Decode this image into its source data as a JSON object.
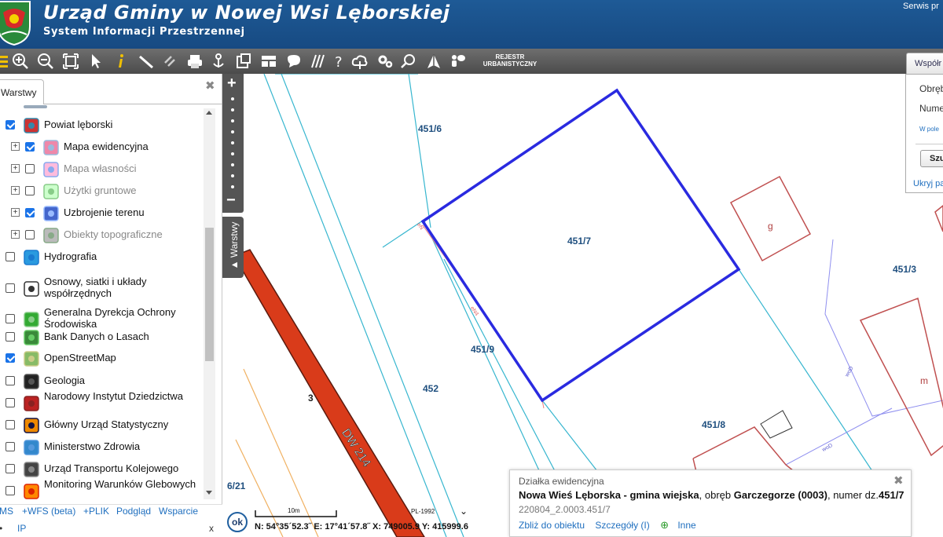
{
  "header": {
    "title": "Urząd Gminy w Nowej Wsi Lęborskiej",
    "subtitle": "System Informacji Przestrzennej",
    "serwis": "Serwis pr"
  },
  "toolbar": {
    "rejestr_line1": "REJESTR",
    "rejestr_line2": "URBANISTYCZNY",
    "tab_label": "Współr"
  },
  "layers_panel": {
    "tab_label": "Warstwy",
    "items": [
      {
        "label": "Powiat lęborski",
        "checked": true,
        "expander": false,
        "dim": false
      },
      {
        "label": "Mapa ewidencyjna",
        "checked": true,
        "expander": true,
        "dim": false
      },
      {
        "label": "Mapa własności",
        "checked": false,
        "expander": true,
        "dim": true
      },
      {
        "label": "Użytki gruntowe",
        "checked": false,
        "expander": true,
        "dim": true
      },
      {
        "label": "Uzbrojenie terenu",
        "checked": true,
        "expander": true,
        "dim": false
      },
      {
        "label": "Obiekty topograficzne",
        "checked": false,
        "expander": true,
        "dim": true
      },
      {
        "label": "Hydrografia",
        "checked": false,
        "expander": false,
        "dim": false
      },
      {
        "label": "Osnowy, siatki i układy współrzędnych",
        "checked": false,
        "expander": false,
        "dim": false
      },
      {
        "label": "Generalna Dyrekcja Ochrony Środowiska",
        "checked": false,
        "expander": false,
        "dim": false
      },
      {
        "label": "Bank Danych o Lasach",
        "checked": false,
        "expander": false,
        "dim": false
      },
      {
        "label": "OpenStreetMap",
        "checked": true,
        "expander": false,
        "dim": false
      },
      {
        "label": "Geologia",
        "checked": false,
        "expander": false,
        "dim": false
      },
      {
        "label": "Narodowy Instytut Dziedzictwa",
        "checked": false,
        "expander": false,
        "dim": false
      },
      {
        "label": "Główny Urząd Statystyczny",
        "checked": false,
        "expander": false,
        "dim": false
      },
      {
        "label": "Ministerstwo Zdrowia",
        "checked": false,
        "expander": false,
        "dim": false
      },
      {
        "label": "Urząd Transportu Kolejowego",
        "checked": false,
        "expander": false,
        "dim": false
      },
      {
        "label": "Monitoring Warunków Glebowych",
        "checked": false,
        "expander": false,
        "dim": false
      }
    ],
    "bottom_links": {
      "wms": "MS",
      "wfs": "+WFS (beta)",
      "plik": "+PLIK",
      "podglad": "Podgląd",
      "wsparcie": "Wsparcie",
      "ip": "IP",
      "close": "x"
    }
  },
  "map": {
    "side_tab": "Warstwy",
    "labels": {
      "p451_6": "451/6",
      "p451_7": "451/7",
      "p451_9": "451/9",
      "p452": "452",
      "p451_8": "451/8",
      "p451_3": "451/3",
      "p6_21": "6/21",
      "num3": "3",
      "bld_g": "g",
      "bld_m": "m",
      "road": "DW 214",
      "line_en": "eN4",
      "line_en2": "eN",
      "line_wod1": "woD",
      "line_wod2": "woD"
    },
    "scale_label": "10m",
    "crs": "PL-1992",
    "ok": "ok",
    "coords": "N: 54°35´52.3˝  E: 17°41´57.8˝  X: 749005.9  Y: 415999.6"
  },
  "search_panel": {
    "obreb": "Obręb",
    "numer": "Nume",
    "hint": "W pole",
    "button": "Szu",
    "hide": "Ukryj pa"
  },
  "popup": {
    "category": "Działka ewidencyjna",
    "place": "Nowa Wieś Lęborska - gmina wiejska",
    "sep1": ", obręb ",
    "obreb": "Garczegorze (0003)",
    "sep2": ", numer dz.",
    "number": "451/7",
    "identifier": "220804_2.0003.451/7",
    "link_zoom": "Zbliż do obiektu",
    "link_details": "Szczegóły (I)",
    "link_more": "Inne"
  }
}
